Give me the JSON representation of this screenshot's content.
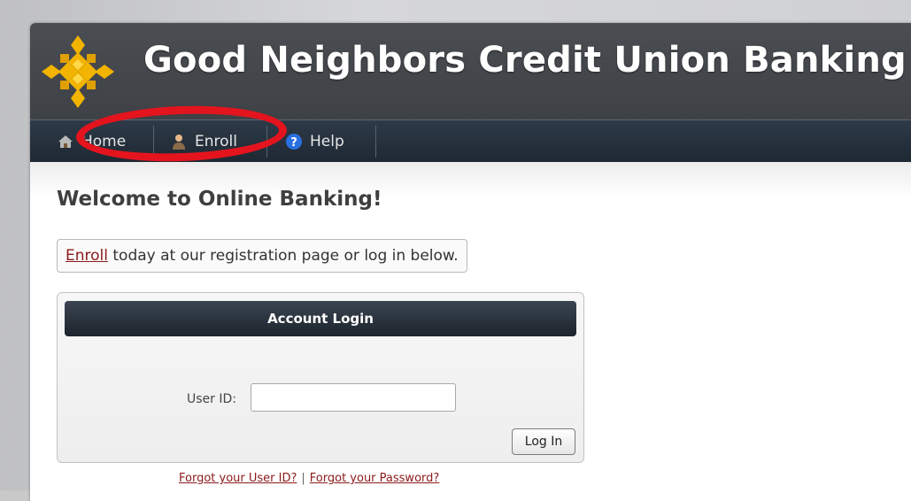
{
  "header": {
    "site_title": "Good Neighbors Credit Union Banking",
    "logo_icon": "gold-diamond-cluster-logo",
    "brand_color": "#f2b400"
  },
  "nav": {
    "items": [
      {
        "label": "Home",
        "icon": "house-icon"
      },
      {
        "label": "Enroll",
        "icon": "person-icon"
      },
      {
        "label": "Help",
        "icon": "help-question-icon"
      }
    ]
  },
  "annotation": {
    "highlight_color": "#e3141d",
    "highlight_target": "Enroll"
  },
  "main": {
    "welcome_heading": "Welcome to Online Banking!",
    "enroll_link": "Enroll",
    "enroll_message": " today at our registration page or log in below."
  },
  "login": {
    "panel_title": "Account Login",
    "userid_label": "User ID:",
    "userid_value": "",
    "login_button": "Log In",
    "forgot_userid": "Forgot your User ID?",
    "forgot_separator": "|",
    "forgot_password": "Forgot your Password?"
  }
}
